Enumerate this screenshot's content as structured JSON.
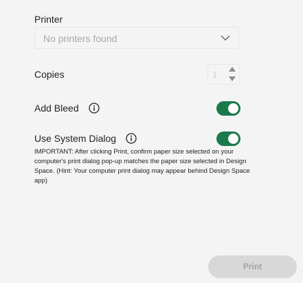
{
  "printer": {
    "label": "Printer",
    "placeholder": "No printers found"
  },
  "copies": {
    "label": "Copies",
    "value": "1"
  },
  "add_bleed": {
    "label": "Add Bleed",
    "enabled": true
  },
  "system_dialog": {
    "label": "Use System Dialog",
    "enabled": true,
    "notice": "IMPORTANT: After clicking Print, confirm paper size selected on your computer's print dialog pop-up matches the paper size selected in Design Space. (Hint: Your computer print dialog may appear behind Design Space app)"
  },
  "actions": {
    "print_label": "Print"
  },
  "colors": {
    "toggle_on": "#1a7a4c",
    "button_disabled": "#d8d8d8"
  },
  "icons": {
    "select": "chevron-down-icon",
    "info": "info-icon"
  }
}
